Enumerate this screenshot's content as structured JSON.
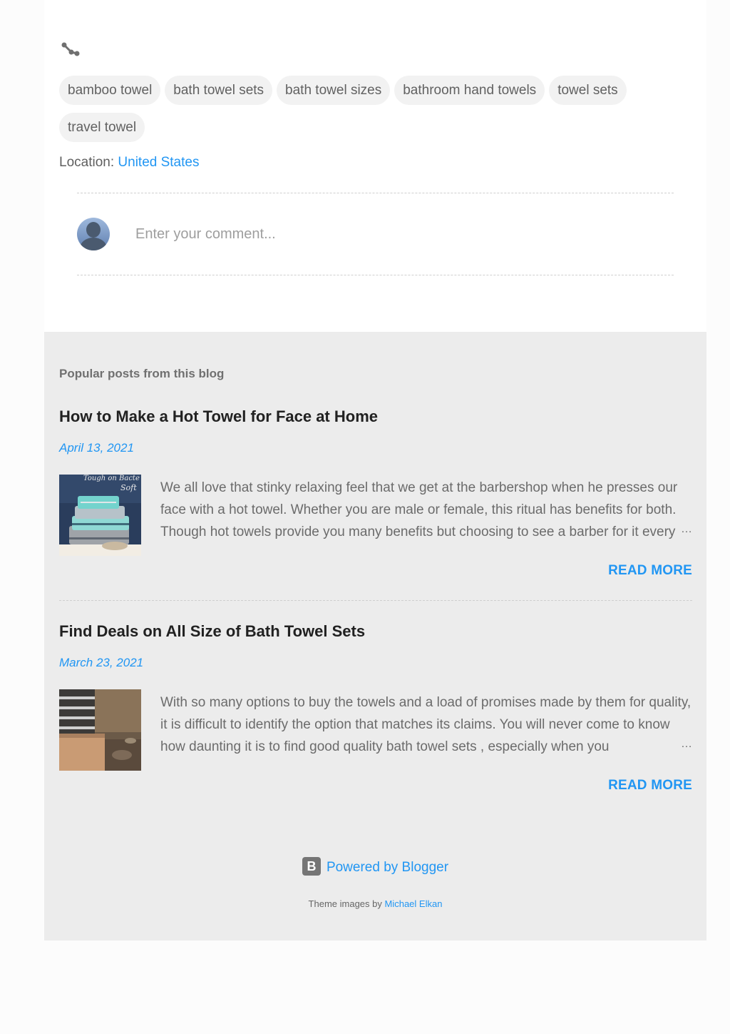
{
  "share": {
    "icon": "share-icon"
  },
  "labels": [
    "bamboo towel",
    "bath towel sets",
    "bath towel sizes",
    "bathroom hand towels",
    "towel sets",
    "travel towel"
  ],
  "location": {
    "label": "Location:",
    "value": "United States"
  },
  "comment": {
    "placeholder": "Enter your comment...",
    "avatar_icon": "user-avatar-icon"
  },
  "popular": {
    "heading": "Popular posts from this blog",
    "posts": [
      {
        "title": "How to Make a Hot Towel for Face at Home",
        "date": "April 13, 2021",
        "snippet": "We all love that stinky relaxing feel that we get at the barbershop when he presses our face with a hot towel. Whether you are male or female, this ritual has benefits for both. Though hot towels provide you many benefits but choosing to see a barber for it every",
        "ellipsis": "…",
        "read_more": "READ MORE",
        "thumb_text": "Tough on Bacte Soft"
      },
      {
        "title": "Find Deals on All Size of Bath Towel Sets",
        "date": "March 23, 2021",
        "snippet": "With so many options to buy the towels and a load of promises made by them for quality, it is difficult to identify the option that matches its claims. You will never come to know how daunting it is to find good quality bath towel sets , especially when you",
        "ellipsis": "…",
        "read_more": "READ MORE"
      }
    ]
  },
  "footer": {
    "powered": "Powered by Blogger",
    "blogger_icon_letter": "B",
    "theme_prefix": "Theme images by",
    "theme_author": "Michael Elkan"
  },
  "colors": {
    "accent": "#2196f3",
    "section_bg": "#ececec",
    "chip_bg": "#f2f2f2"
  }
}
